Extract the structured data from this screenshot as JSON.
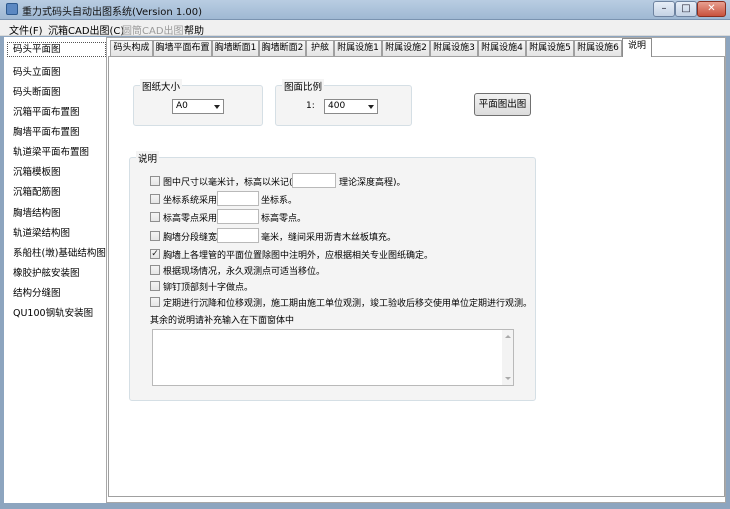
{
  "window": {
    "title": "重力式码头自动出图系统(Version 1.00)"
  },
  "window_controls": {
    "minimize": "–",
    "maximize": "□",
    "close": "✕"
  },
  "menu": [
    {
      "label": "文件(F)",
      "enabled": true
    },
    {
      "label": "沉箱CAD出图(C)",
      "enabled": true
    },
    {
      "label": "圆筒CAD出图",
      "enabled": false
    },
    {
      "label": "帮助",
      "enabled": true
    }
  ],
  "sidebar": {
    "selected_index": 0,
    "items": [
      "码头平面图",
      "码头立面图",
      "码头断面图",
      "沉箱平面布置图",
      "胸墙平面布置图",
      "轨道梁平面布置图",
      "沉箱模板图",
      "沉箱配筋图",
      "胸墙结构图",
      "轨道梁结构图",
      "系船柱(墩)基础结构图",
      "橡胶护舷安装图",
      "结构分缝图",
      "QU100钢轨安装图"
    ]
  },
  "tabs": {
    "active_index": 11,
    "items": [
      "码头构成",
      "胸墙平面布置",
      "胸墙断面1",
      "胸墙断面2",
      "护舷",
      "附属设施1",
      "附属设施2",
      "附属设施3",
      "附属设施4",
      "附属设施5",
      "附属设施6",
      "说明"
    ]
  },
  "paper_size": {
    "label": "图纸大小",
    "value": "A0"
  },
  "scale": {
    "label": "图面比例",
    "prefix": "1:",
    "value": "400"
  },
  "plot_button": "平面图出图",
  "notes": {
    "label": "说明",
    "items": [
      {
        "checked": false,
        "text_before": "图中尺寸以毫米计，标高以米记(",
        "field": "",
        "text_after": "理论深度高程)。"
      },
      {
        "checked": false,
        "text_before": "坐标系统采用",
        "field": "",
        "text_after": "坐标系。"
      },
      {
        "checked": false,
        "text_before": "标高零点采用",
        "field": "",
        "text_after": "标高零点。"
      },
      {
        "checked": false,
        "text_before": "胸墙分段缝宽",
        "field": "",
        "text_after": "毫米，缝间采用沥青木丝板填充。"
      },
      {
        "checked": true,
        "text_before": "胸墙上各埋管的平面位置除图中注明外，应根据相关专业图纸确定。"
      },
      {
        "checked": false,
        "text_before": "根据现场情况，永久观测点可适当移位。"
      },
      {
        "checked": false,
        "text_before": "铆钉顶部刻十字做点。"
      },
      {
        "checked": false,
        "text_before": "定期进行沉降和位移观测，施工期由施工单位观测，竣工验收后移交使用单位定期进行观测。"
      }
    ],
    "extra_label": "其余的说明请补充输入在下面窗体中",
    "extra_text": ""
  }
}
